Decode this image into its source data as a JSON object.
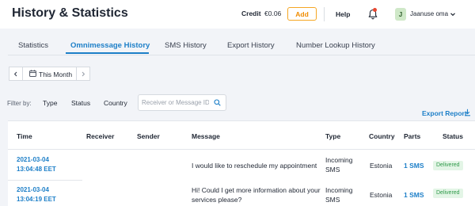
{
  "header": {
    "title": "History & Statistics",
    "credit_label": "Credit",
    "credit_value": "€0.06",
    "add_label": "Add",
    "help_label": "Help",
    "user_initial": "J",
    "user_name": "Jaanuse oma",
    "notification_dot_color": "#e8462f"
  },
  "tabs": [
    {
      "label": "Statistics",
      "active": false
    },
    {
      "label": "Omnimessage History",
      "active": true
    },
    {
      "label": "SMS History",
      "active": false
    },
    {
      "label": "Export History",
      "active": false
    },
    {
      "label": "Number Lookup History",
      "active": false
    }
  ],
  "period": {
    "label": "This Month",
    "prev_icon": "chevron-left-icon",
    "next_icon": "chevron-right-icon"
  },
  "filters": {
    "label": "Filter by:",
    "options": [
      "Type",
      "Status",
      "Country"
    ],
    "search_placeholder": "Receiver or Message ID"
  },
  "export_label": "Export Report",
  "table": {
    "columns": [
      "Time",
      "Receiver",
      "Sender",
      "Message",
      "Type",
      "Country",
      "Parts",
      "Status"
    ],
    "rows": [
      {
        "time_date": "2021-03-04",
        "time_clock": "13:04:48 EET",
        "receiver": "",
        "sender": "",
        "message": "I would like to reschedule my appointment",
        "type_line1": "Incoming",
        "type_line2": "SMS",
        "country": "Estonia",
        "parts": "1 SMS",
        "status": "Delivered"
      },
      {
        "time_date": "2021-03-04",
        "time_clock": "13:04:19 EET",
        "receiver": "",
        "sender": "",
        "message_line1": "Hi! Could I get more information about your",
        "message_line2": "services please?",
        "type_line1": "Incoming",
        "type_line2": "SMS",
        "country": "Estonia",
        "parts": "1 SMS",
        "status": "Delivered"
      }
    ]
  },
  "colors": {
    "accent": "#1d7fc8",
    "add_button": "#f08c00",
    "delivered_bg": "#e3f5e6",
    "delivered_text": "#2f9a4a"
  }
}
